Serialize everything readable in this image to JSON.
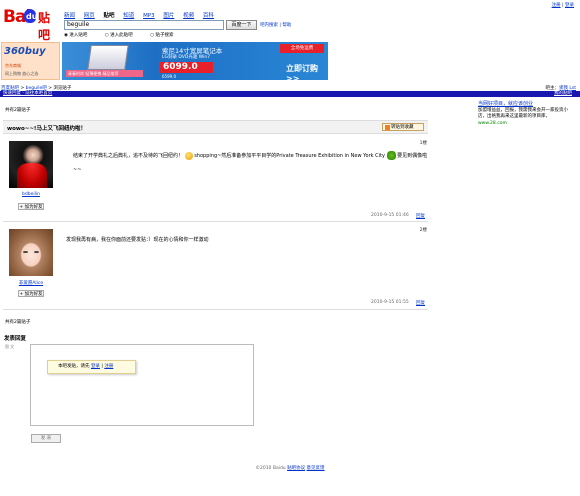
{
  "logo": {
    "part1": "Bai",
    "paw": "du",
    "part2": "贴吧"
  },
  "nav": {
    "items": [
      "新闻",
      "网页",
      "贴吧",
      "知道",
      "MP3",
      "图片",
      "视频",
      "百科"
    ],
    "current_index": 2
  },
  "top_links": {
    "register": "注册",
    "login": "登录"
  },
  "search": {
    "value": "beguile",
    "button": "百度一下",
    "links": "吧内搜索 | 帮助"
  },
  "radios": [
    "进入贴吧",
    "进入此贴吧",
    "贴子搜索"
  ],
  "ad_left": {
    "line1": "360buy",
    "line2": "京东商城",
    "line3": "网上购物 放心之选"
  },
  "ad_main": {
    "caption": "青春时尚 轻薄便携 精品推荐",
    "title": "索尼14寸宽屏笔记本",
    "subtitle": "LG刻录 DVD光驱 Win7",
    "price": "6099.0",
    "price2": "6599.0",
    "buy": "立即订购 >>",
    "tag": "全场免运费"
  },
  "breadcrumb": {
    "home": "百度贴吧",
    "sep": ">",
    "forum": "beguile吧",
    "current": "浏览贴子"
  },
  "right_info": {
    "label": "吧主：",
    "value": "诶我 Lst"
  },
  "blue_bar": {
    "left": "快速回复 · 前往本吧首页",
    "right": "我的贴吧"
  },
  "posts_count": "共有2篇贴子",
  "sidebar_ad": {
    "title": "当网好项目，就应该创业",
    "body": "加盟增益益，回报，我需我来会开一家投资小店，出格我再来这里最新的项目库，",
    "url": "www.28.com"
  },
  "thread": {
    "title": "wowo~~!马上又飞回纽约啦！",
    "share_button": "转贴到收藏"
  },
  "posts": [
    {
      "floor": "1楼",
      "user": "bdbeilin",
      "add_friend": "+ 加为好友",
      "text_a": "结束了开学典礼之后典礼，追不及待的飞回纽约！",
      "text_b": "shopping~然后准备参加平平目学的Private Treasure Exhibition in New York City",
      "text_c": "要见到偶像啦~~",
      "time": "2010-9-15 01:46",
      "reply": "回复"
    },
    {
      "floor": "2楼",
      "user": "非爱愿Alice",
      "add_friend": "+ 加为好友",
      "text": "发现我再有病，我在你面前还要发贴：）现在的心情和你一样激动",
      "time": "2010-9-15 01:55",
      "reply": "回复"
    }
  ],
  "posts_count_bottom": "共有2篇贴子",
  "reply": {
    "header": "发表回复",
    "icons": "图 文",
    "tip_text": "本吧发贴，请先",
    "tip_login": "登录",
    "tip_sep": "|",
    "tip_register": "注册",
    "submit": "发 表"
  },
  "footer": {
    "text": "©2010 Baidu ",
    "link1": "贴吧协议",
    "link2": "意见反馈"
  }
}
